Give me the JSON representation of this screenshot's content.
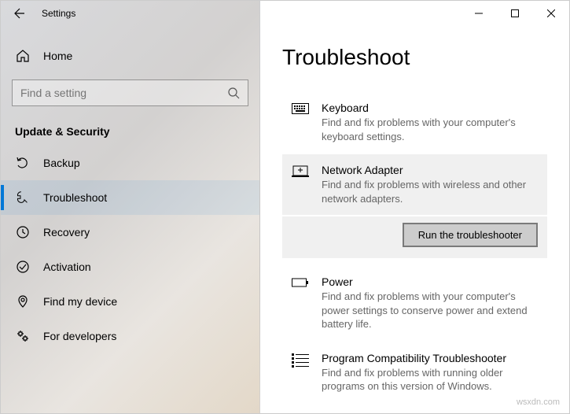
{
  "titlebar": {
    "title": "Settings"
  },
  "sidebar": {
    "home": "Home",
    "search_placeholder": "Find a setting",
    "section": "Update & Security",
    "items": [
      {
        "label": "Backup"
      },
      {
        "label": "Troubleshoot"
      },
      {
        "label": "Recovery"
      },
      {
        "label": "Activation"
      },
      {
        "label": "Find my device"
      },
      {
        "label": "For developers"
      }
    ]
  },
  "main": {
    "heading": "Troubleshoot",
    "run_label": "Run the troubleshooter",
    "items": [
      {
        "name": "Keyboard",
        "desc": "Find and fix problems with your computer's keyboard settings."
      },
      {
        "name": "Network Adapter",
        "desc": "Find and fix problems with wireless and other network adapters."
      },
      {
        "name": "Power",
        "desc": "Find and fix problems with your computer's power settings to conserve power and extend battery life."
      },
      {
        "name": "Program Compatibility Troubleshooter",
        "desc": "Find and fix problems with running older programs on this version of Windows."
      }
    ]
  },
  "watermark": "wsxdn.com"
}
